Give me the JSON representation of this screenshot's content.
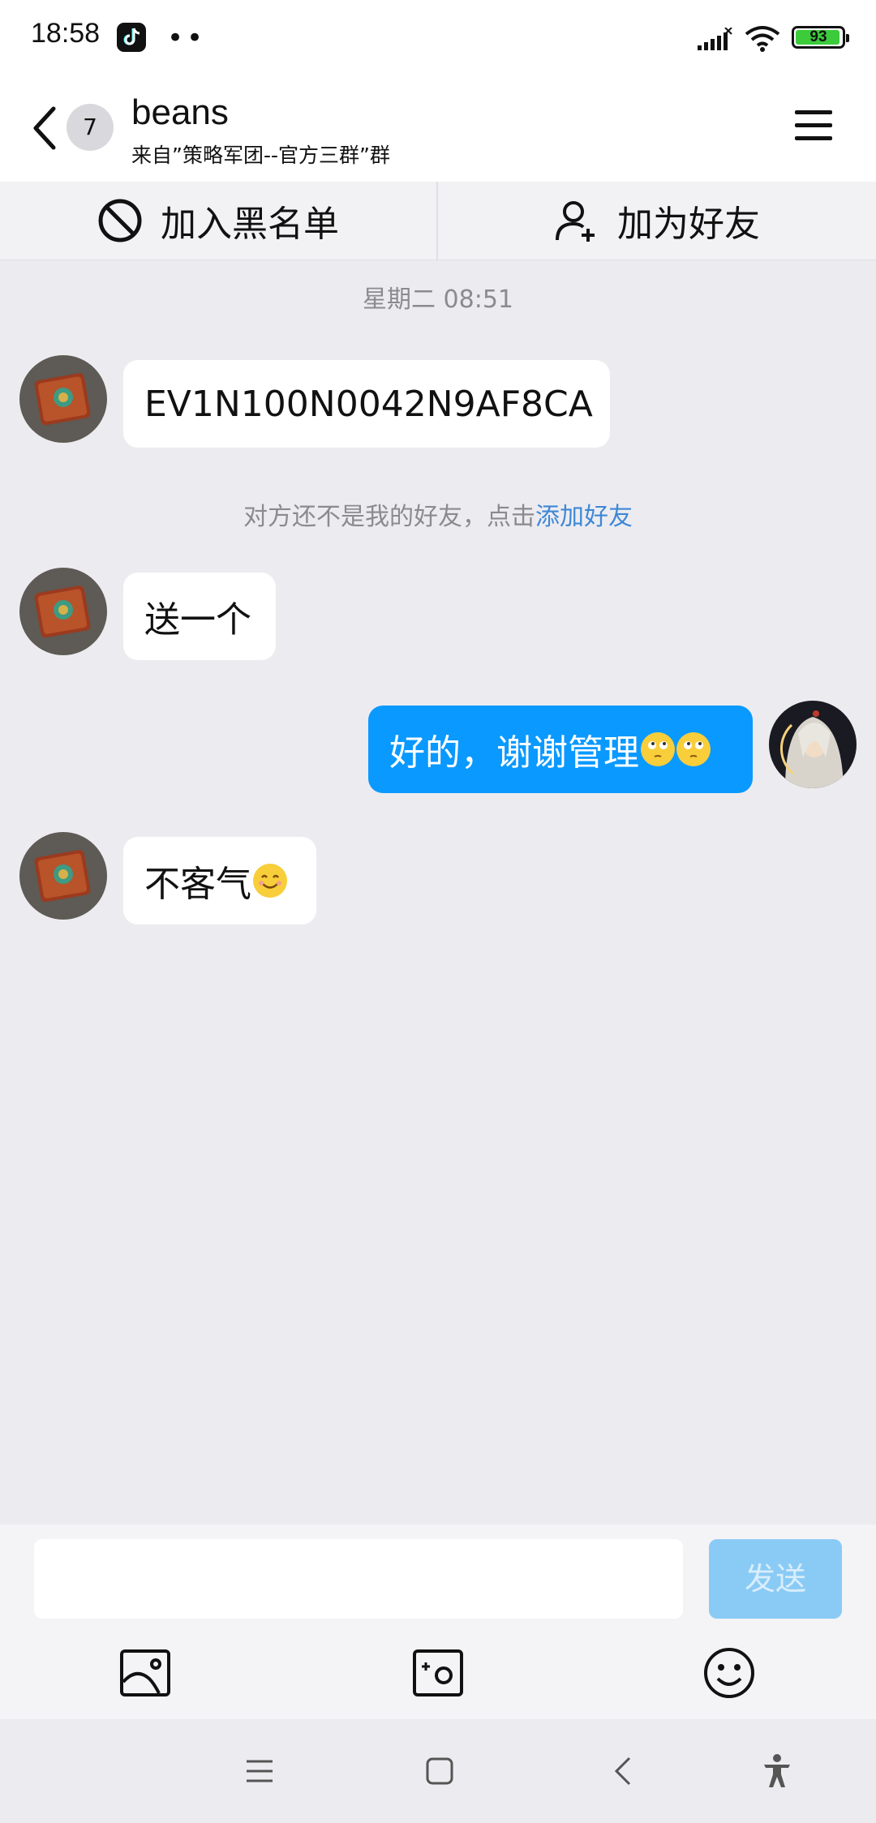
{
  "status_bar": {
    "time": "18:58",
    "battery": "93"
  },
  "header": {
    "unread_count": "7",
    "title": "beans",
    "subtitle": "来自”策略军团--官方三群”群"
  },
  "actions": {
    "blacklist_label": "加入黑名单",
    "add_friend_label": "加为好友"
  },
  "chat": {
    "timestamp": "星期二 08:51",
    "system_note_prefix": "对方还不是我的好友，点击",
    "system_note_link": "添加好友",
    "messages": [
      {
        "direction": "in",
        "text": "EV1N100N0042N9AF8CA"
      },
      {
        "direction": "in",
        "text": "送一个"
      },
      {
        "direction": "out",
        "text": "好的，谢谢管理"
      },
      {
        "direction": "in",
        "text": "不客气"
      }
    ]
  },
  "composer": {
    "input_value": "",
    "send_label": "发送"
  },
  "colors": {
    "accent": "#0A99FF",
    "link": "#3F87D6",
    "background": "#ECECF0"
  }
}
